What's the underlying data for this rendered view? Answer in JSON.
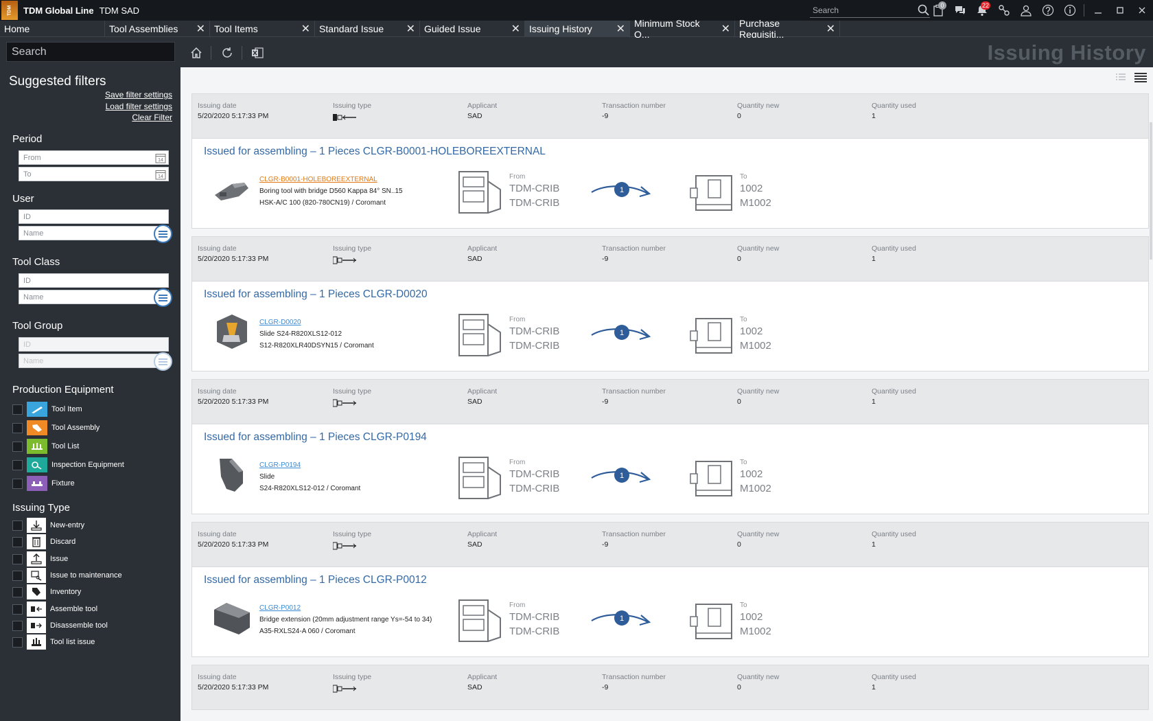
{
  "app": {
    "logo_text": "TDM",
    "name": "TDM Global Line",
    "user": "TDM SAD"
  },
  "top_search": {
    "placeholder": "Search"
  },
  "top_icons": {
    "msg_badge": "0",
    "notif_badge": "22"
  },
  "tabs": [
    {
      "label": "Home"
    },
    {
      "label": "Tool Assemblies"
    },
    {
      "label": "Tool Items"
    },
    {
      "label": "Standard Issue"
    },
    {
      "label": "Guided Issue"
    },
    {
      "label": "Issuing History"
    },
    {
      "label": "Minimum Stock Q..."
    },
    {
      "label": "Purchase Requisiti..."
    }
  ],
  "toolbar": {
    "search_placeholder": "Search",
    "page_title": "Issuing History"
  },
  "sidebar": {
    "title": "Suggested filters",
    "save_filter": "Save filter settings",
    "load_filter": "Load filter settings",
    "clear_filter": "Clear Filter",
    "period": {
      "label": "Period",
      "from": "From",
      "to": "To"
    },
    "user": {
      "label": "User",
      "id": "ID",
      "name": "Name"
    },
    "tool_class": {
      "label": "Tool Class",
      "id": "ID",
      "name": "Name"
    },
    "tool_group": {
      "label": "Tool Group",
      "id": "ID",
      "name": "Name"
    },
    "production_equipment": {
      "label": "Production Equipment",
      "items": [
        "Tool Item",
        "Tool Assembly",
        "Tool List",
        "Inspection Equipment",
        "Fixture"
      ]
    },
    "issuing_type": {
      "label": "Issuing Type",
      "items": [
        "New-entry",
        "Discard",
        "Issue",
        "Issue to maintenance",
        "Inventory",
        "Assemble tool",
        "Disassemble tool",
        "Tool list issue"
      ]
    }
  },
  "labels": {
    "issuing_date": "Issuing date",
    "issuing_type": "Issuing type",
    "applicant": "Applicant",
    "transaction_number": "Transaction number",
    "quantity_new": "Quantity new",
    "quantity_used": "Quantity used",
    "from": "From",
    "to": "To"
  },
  "records": [
    {
      "date": "5/20/2020 5:17:33 PM",
      "applicant": "SAD",
      "transaction": "-9",
      "qty_new": "0",
      "qty_used": "1",
      "title": "Issued for assembling – 1 Pieces CLGR-B0001-HOLEBOREEXTERNAL",
      "tool_id": "CLGR-B0001-HOLEBOREEXTERNAL",
      "desc1": "Boring tool with bridge D560 Kappa 84° SN..15",
      "desc2": "HSK-A/C 100 (820-780CN19) / Coromant",
      "from1": "TDM-CRIB",
      "from2": "TDM-CRIB",
      "to1": "1002",
      "to2": "M1002",
      "flow_count": "1"
    },
    {
      "date": "5/20/2020 5:17:33 PM",
      "applicant": "SAD",
      "transaction": "-9",
      "qty_new": "0",
      "qty_used": "1",
      "title": "Issued for assembling – 1 Pieces CLGR-D0020",
      "tool_id": "CLGR-D0020",
      "desc1": "Slide S24-R820XLS12-012",
      "desc2": "S12-R820XLR40DSYN15 / Coromant",
      "from1": "TDM-CRIB",
      "from2": "TDM-CRIB",
      "to1": "1002",
      "to2": "M1002",
      "flow_count": "1"
    },
    {
      "date": "5/20/2020 5:17:33 PM",
      "applicant": "SAD",
      "transaction": "-9",
      "qty_new": "0",
      "qty_used": "1",
      "title": "Issued for assembling – 1 Pieces CLGR-P0194",
      "tool_id": "CLGR-P0194",
      "desc1": "Slide",
      "desc2": "S24-R820XLS12-012 / Coromant",
      "from1": "TDM-CRIB",
      "from2": "TDM-CRIB",
      "to1": "1002",
      "to2": "M1002",
      "flow_count": "1"
    },
    {
      "date": "5/20/2020 5:17:33 PM",
      "applicant": "SAD",
      "transaction": "-9",
      "qty_new": "0",
      "qty_used": "1",
      "title": "Issued for assembling – 1 Pieces CLGR-P0012",
      "tool_id": "CLGR-P0012",
      "desc1": "Bridge extension (20mm adjustment range Ys=-54 to 34)",
      "desc2": "A35-RXLS24-A 060 / Coromant",
      "from1": "TDM-CRIB",
      "from2": "TDM-CRIB",
      "to1": "1002",
      "to2": "M1002",
      "flow_count": "1"
    },
    {
      "date": "5/20/2020 5:17:33 PM",
      "applicant": "SAD",
      "transaction": "-9",
      "qty_new": "0",
      "qty_used": "1"
    }
  ]
}
